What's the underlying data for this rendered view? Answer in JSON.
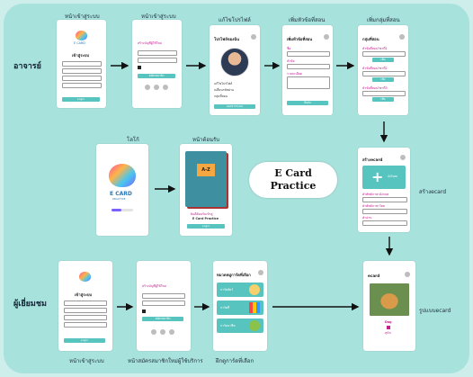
{
  "rows": {
    "teacher": "อาจารย์",
    "student": "ผู้เยี่ยมชม"
  },
  "top_labels": {
    "login": "หน้าเข้าสู่ระบบ",
    "login2": "หน้าเข้าสู่ระบบ",
    "profile": "แก้ไขโปรไฟล์",
    "add_subject": "เพิ่มหัวข้อที่สอน",
    "add_group": "เพิ่มกลุ่มที่สอน"
  },
  "middle_labels": {
    "logo": "โลโก้",
    "welcome": "หน้าต้อนรับ",
    "create_ecard": "สร้างecard"
  },
  "bottom_labels": {
    "login": "หน้าเข้าสู่ระบบ",
    "register": "หน้าสมัครสมาชิกใหม่ผู้ใช้บริการ",
    "practice": "ฝึกดูการ์ดที่เลือก",
    "ecard_view": "รูปแบบecard"
  },
  "center_title": {
    "line1": "E Card",
    "line2": "Practice"
  },
  "screens": {
    "login": {
      "title": "เข้าสู่ระบบ",
      "button": "Login",
      "logo_text": "E CARD"
    },
    "register": {
      "title": "สร้างบัญชีผู้ใช้ใหม่",
      "button": "สมัครสมาชิก"
    },
    "profile": {
      "title": "โปรไฟล์ของฉัน",
      "items": [
        "แก้ไขโปรไฟล์",
        "เปลี่ยนรหัสผ่าน",
        "กลุ่มที่สอน"
      ],
      "button": "ออกจากระบบ"
    },
    "subject": {
      "title": "เพิ่มหัวข้อที่สอน",
      "fields": [
        "ชื่อ",
        "หัวข้อ",
        "รายละเอียด"
      ],
      "button": "ยืนยัน"
    },
    "group": {
      "title": "กลุ่มที่สอน",
      "items": [
        "หัวข้อที่สอนวิชาที่1",
        "หัวข้อที่สอนวิชาที่2",
        "หัวข้อที่สอนวิชาที่3"
      ],
      "button": "เพิ่ม"
    },
    "splash": {
      "logo_text": "E CARD",
      "sub_text": "PRACTICE"
    },
    "welcome": {
      "book_text": "A-Z",
      "line1": "ยินดีต้อนรับเข้าสู่",
      "line2": "E Card Practice",
      "button": "Login"
    },
    "create": {
      "title": "สร้างecard",
      "add_label": "อัปโหลด",
      "fields": [
        "คำศัพท์ภาษาอังกฤษ",
        "คำศัพท์ภาษาไทย",
        "คำอ่าน"
      ]
    },
    "practice": {
      "title": "หมวดหมู่การ์ดที่เลือก",
      "cards": [
        "การ์ดสัตว์",
        "การ์ดสี",
        "การ์ดอาชีพ"
      ]
    },
    "ecard": {
      "title": "ecard",
      "word": "Dog",
      "thai": "สุนัข"
    }
  },
  "colors": {
    "background": "#cdeeea",
    "board": "#a8e2dc",
    "accent": "#57c4bf",
    "book_cover": "#3e8fa0"
  }
}
